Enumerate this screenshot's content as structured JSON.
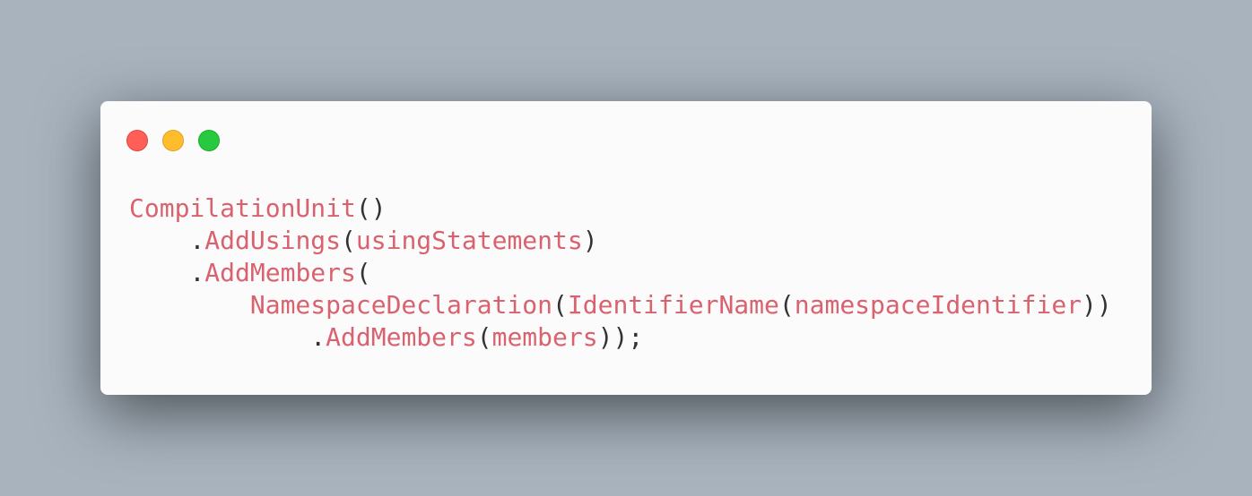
{
  "window": {
    "controls": {
      "close_color": "#ff5f56",
      "minimize_color": "#ffbd2e",
      "maximize_color": "#27c93f"
    }
  },
  "code": {
    "lines": [
      {
        "indent": "",
        "tokens": [
          {
            "type": "fn",
            "text": "CompilationUnit"
          },
          {
            "type": "punc",
            "text": "()"
          }
        ]
      },
      {
        "indent": "    ",
        "tokens": [
          {
            "type": "punc",
            "text": "."
          },
          {
            "type": "fn",
            "text": "AddUsings"
          },
          {
            "type": "punc",
            "text": "("
          },
          {
            "type": "arg",
            "text": "usingStatements"
          },
          {
            "type": "punc",
            "text": ")"
          }
        ]
      },
      {
        "indent": "    ",
        "tokens": [
          {
            "type": "punc",
            "text": "."
          },
          {
            "type": "fn",
            "text": "AddMembers"
          },
          {
            "type": "punc",
            "text": "("
          }
        ]
      },
      {
        "indent": "        ",
        "tokens": [
          {
            "type": "fn",
            "text": "NamespaceDeclaration"
          },
          {
            "type": "punc",
            "text": "("
          },
          {
            "type": "fn",
            "text": "IdentifierName"
          },
          {
            "type": "punc",
            "text": "("
          },
          {
            "type": "arg",
            "text": "namespaceIdentifier"
          },
          {
            "type": "punc",
            "text": "))"
          }
        ]
      },
      {
        "indent": "            ",
        "tokens": [
          {
            "type": "punc",
            "text": "."
          },
          {
            "type": "fn",
            "text": "AddMembers"
          },
          {
            "type": "punc",
            "text": "("
          },
          {
            "type": "arg",
            "text": "members"
          },
          {
            "type": "punc",
            "text": "));"
          }
        ]
      }
    ]
  },
  "colors": {
    "background": "#a8b3be",
    "window": "#fbfbfb",
    "identifier": "#d9626f",
    "punctuation": "#333333"
  }
}
